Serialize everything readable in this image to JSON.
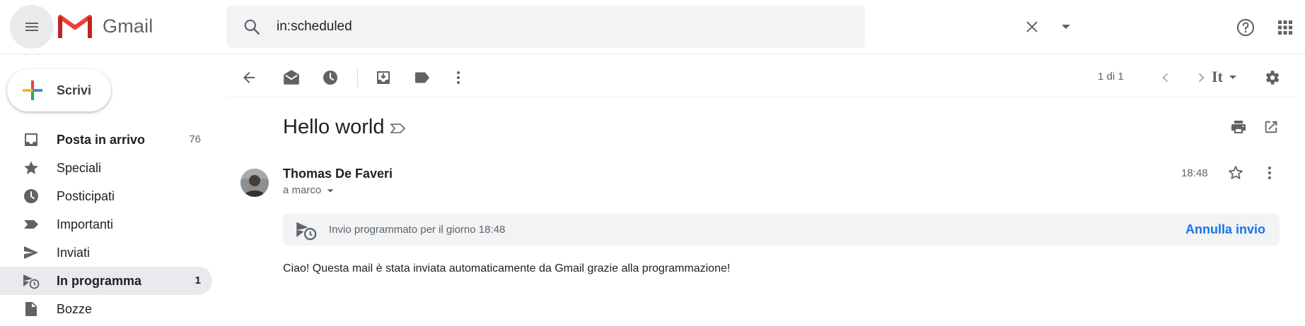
{
  "app": {
    "name": "Gmail"
  },
  "search": {
    "value": "in:scheduled"
  },
  "compose": {
    "label": "Scrivi"
  },
  "sidebar": {
    "items": [
      {
        "label": "Posta in arrivo",
        "count": "76",
        "icon": "inbox-icon"
      },
      {
        "label": "Speciali",
        "count": "",
        "icon": "star-icon"
      },
      {
        "label": "Posticipati",
        "count": "",
        "icon": "clock-icon"
      },
      {
        "label": "Importanti",
        "count": "",
        "icon": "important-icon"
      },
      {
        "label": "Inviati",
        "count": "",
        "icon": "send-icon"
      },
      {
        "label": "In programma",
        "count": "1",
        "icon": "scheduled-icon"
      },
      {
        "label": "Bozze",
        "count": "",
        "icon": "draft-icon"
      }
    ]
  },
  "toolbar": {
    "pager": "1 di 1",
    "input_tool": "It"
  },
  "message": {
    "subject": "Hello world",
    "sender": "Thomas De Faveri",
    "recipient": "a marco",
    "time": "18:48",
    "scheduled_notice": "Invio programmato per il giorno 18:48",
    "cancel_label": "Annulla invio",
    "body": "Ciao! Questa mail è stata inviata automaticamente da Gmail grazie alla programmazione!"
  },
  "colors": {
    "accent": "#1a73e8",
    "gmail_red": "#ea4335",
    "icon_gray": "#5f6368",
    "active_bg": "#e8eaed"
  }
}
